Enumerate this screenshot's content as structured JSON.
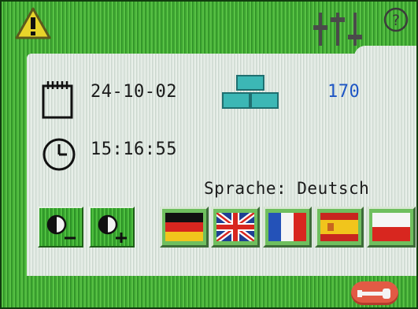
{
  "status": {
    "date": "24-10-02",
    "time": "15:16:55",
    "pallet_count": "170",
    "language_label": "Sprache: Deutsch"
  },
  "icons": {
    "warning": "warning-triangle-icon",
    "sliders": "sliders-icon",
    "help": "help-icon",
    "calendar": "calendar-icon",
    "pallets": "stacked-blocks-icon",
    "clock": "clock-icon",
    "contrast_down": "contrast-decrease-icon",
    "contrast_up": "contrast-increase-icon",
    "tool": "wrench-icon"
  },
  "languages": [
    "de",
    "gb",
    "fr",
    "es",
    "pl"
  ],
  "colors": {
    "accent_green": "#3fa832",
    "panel": "#e6ece7",
    "count_blue": "#1d55c4",
    "warning_yellow": "#e8d42a",
    "tool_red": "#e25a45"
  }
}
